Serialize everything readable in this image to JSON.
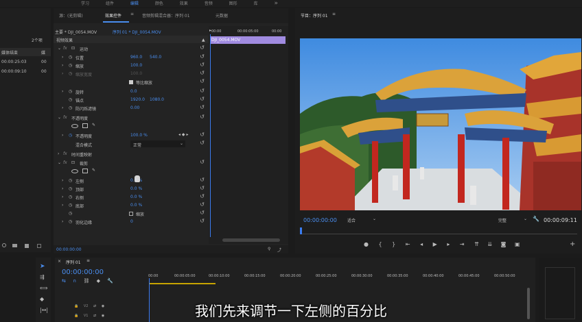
{
  "top_menu": [
    "学习",
    "组件",
    "编辑",
    "颜色",
    "效果",
    "音频",
    "图形",
    "库"
  ],
  "top_menu_more": "»",
  "project": {
    "items_count": "2个项",
    "col_media_end": "媒体结束",
    "col_media_dur": "媒",
    "rows": [
      {
        "end": "00:00:25:03",
        "dur": "00"
      },
      {
        "end": "00:00:09:10",
        "dur": "00"
      }
    ]
  },
  "effect_controls": {
    "tabs": [
      "源：(无剪辑)",
      "效果控件",
      "音频剪辑混合器：序列 01",
      "元数据"
    ],
    "tab_menu": "≡",
    "master": "主要 * DJI_0054.MOV",
    "seq": "序列 01 * DJI_0054.MOV",
    "video_effects": "视频效果",
    "motion": "运动",
    "position_label": "位置",
    "position_x": "960.0",
    "position_y": "540.0",
    "scale_label": "缩放",
    "scale_val": "100.0",
    "scale_width_label": "缩放宽度",
    "scale_width_val": "100.0",
    "uniform_scale": "等比缩放",
    "rotation_label": "旋转",
    "rotation_val": "0.0",
    "anchor_label": "锚点",
    "anchor_x": "1920.0",
    "anchor_y": "1080.0",
    "flicker_label": "防闪烁滤镜",
    "flicker_val": "0.00",
    "opacity": "不透明度",
    "opacity_label": "不透明度",
    "opacity_val": "100.0 %",
    "blend_label": "混合模式",
    "blend_val": "正常",
    "time_remap": "时间重映射",
    "crop": "裁剪",
    "left_label": "左侧",
    "left_val": "0.0 %",
    "top_label": "顶部",
    "top_val": "0.0 %",
    "right_label": "右侧",
    "right_val": "0.0 %",
    "bottom_label": "底部",
    "bottom_val": "0.0 %",
    "zoom_label": "缩放",
    "feather_label": "羽化边缘",
    "feather_val": "0",
    "timecode": "00:00:00:00",
    "ruler": [
      "00:00",
      "00:00:05:00",
      "00:00"
    ],
    "clip_name": "DJI_0054.MOV"
  },
  "program": {
    "title": "节目：序列 01",
    "menu": "≡",
    "timecode": "00:00:00:00",
    "fit": "适合",
    "quality": "完整",
    "duration": "00:00:09:11"
  },
  "timeline": {
    "title": "序列 01",
    "menu": "≡",
    "timecode": "00:00:00:00",
    "ruler": [
      "00:00",
      "00:00:05:00",
      "00:00:10:00",
      "00:00:15:00",
      "00:00:20:00",
      "00:00:25:00",
      "00:00:30:00",
      "00:00:35:00",
      "00:00:40:00",
      "00:00:45:00",
      "00:00:50:00"
    ],
    "tracks": [
      "V2",
      "V1"
    ]
  },
  "subtitle": "我们先来调节一下左侧的百分比",
  "colors": {
    "accent_blue": "#4a8ef0",
    "clip_purple": "#a08be0",
    "playhead": "#3b7cf0"
  }
}
